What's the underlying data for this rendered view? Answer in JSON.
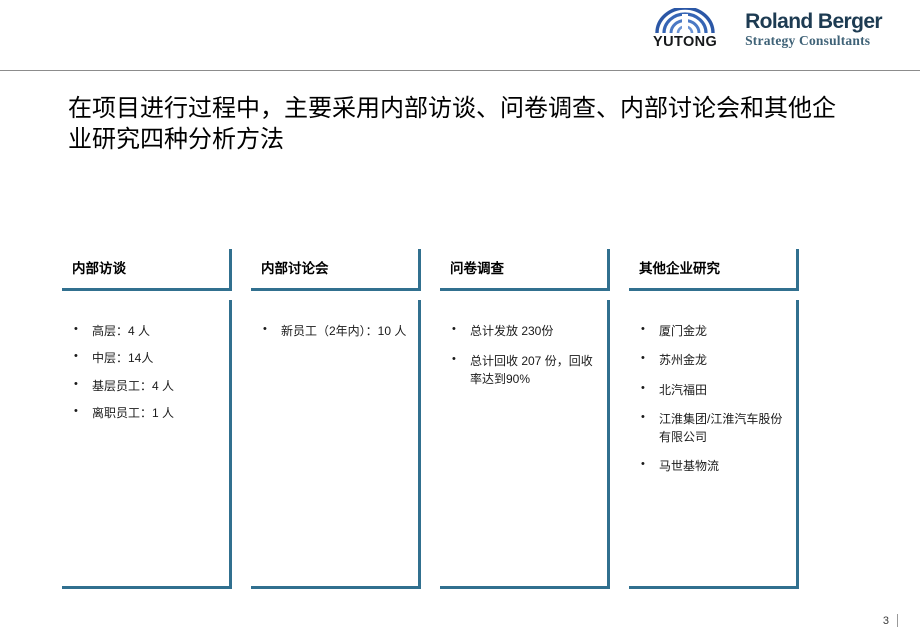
{
  "header": {
    "yutong_logo": {
      "wordmark": "YUTONG",
      "icon": "yutong-arcs-icon"
    },
    "roland_berger_logo": {
      "name": "Roland Berger",
      "tagline": "Strategy Consultants"
    }
  },
  "title": "在项目进行过程中，主要采用内部访谈、问卷调查、内部讨论会和其他企业研究四种分析方法",
  "columns": [
    {
      "heading": "内部访谈",
      "items": [
        "高层：4 人",
        "中层：14人",
        "基层员工：4 人",
        "离职员工：1 人"
      ]
    },
    {
      "heading": "内部讨论会",
      "items": [
        "新员工（2年内）：10 人"
      ]
    },
    {
      "heading": "问卷调查",
      "items": [
        "总计发放 230份",
        "总计回收 207 份，回收率达到90%"
      ]
    },
    {
      "heading": "其他企业研究",
      "items": [
        "厦门金龙",
        "苏州金龙",
        "北汽福田",
        "江淮集团/江淮汽车股份有限公司",
        "马世基物流"
      ]
    }
  ],
  "footer": {
    "page_number": "3"
  },
  "colors": {
    "box_border": "#31708f",
    "rb_navy": "#1d3b52",
    "rb_slate": "#3f6277",
    "yutong_blue": "#2b57a6",
    "header_rule": "#8c8c8c"
  }
}
